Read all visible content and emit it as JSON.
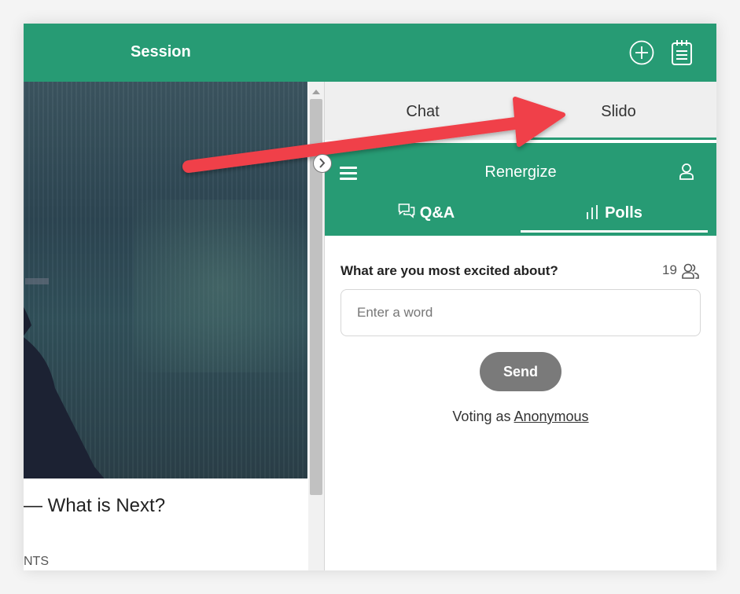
{
  "header": {
    "title": "Session",
    "add_icon": "plus-circle-icon",
    "notes_icon": "notepad-icon",
    "color": "#279b74"
  },
  "main": {
    "session_title": "— What is Next?",
    "section_label": "NTS"
  },
  "side_panel": {
    "tabs": [
      {
        "label": "Chat",
        "active": false
      },
      {
        "label": "Slido",
        "active": true
      }
    ]
  },
  "slido": {
    "event_name": "Renergize",
    "subtabs": [
      {
        "label": "Q&A",
        "icon": "speech-bubbles-icon",
        "active": false
      },
      {
        "label": "Polls",
        "icon": "bar-chart-icon",
        "active": true
      }
    ],
    "poll": {
      "question": "What are you most excited about?",
      "participant_count": "19",
      "input_placeholder": "Enter a word",
      "send_label": "Send"
    },
    "voting_prefix": "Voting as ",
    "voting_name": "Anonymous"
  },
  "annotation": {
    "type": "arrow",
    "color": "#f0404a"
  }
}
